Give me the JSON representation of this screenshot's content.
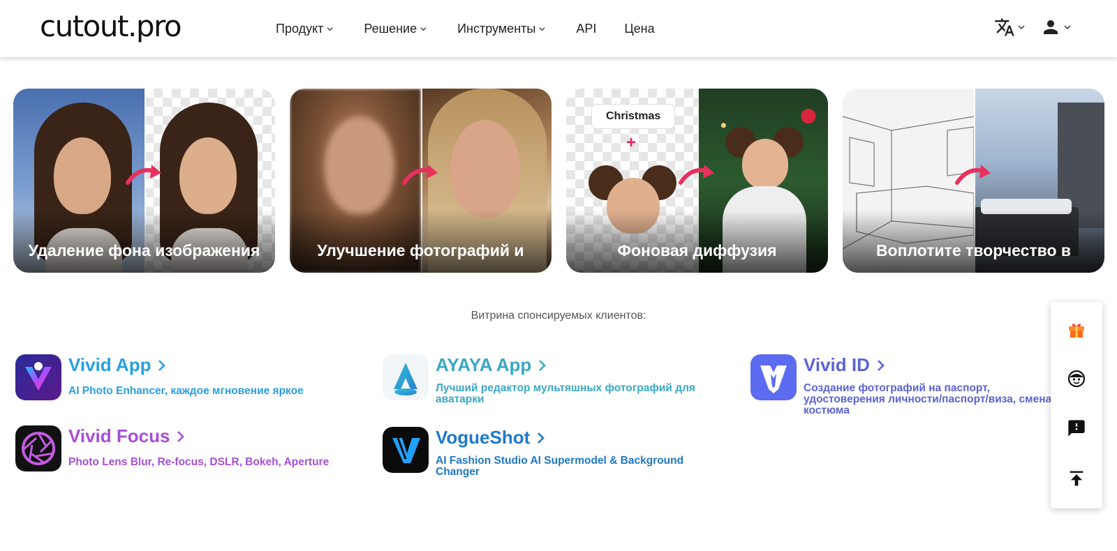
{
  "header": {
    "logo": "cutout.pro",
    "nav": [
      "Продукт",
      "Решение",
      "Инструменты",
      "API",
      "Цена"
    ],
    "icons": [
      "translate-icon",
      "user-icon"
    ]
  },
  "cards": [
    {
      "caption": "Удаление фона изображения"
    },
    {
      "caption": "Улучшение фотографий и"
    },
    {
      "caption": "Фоновая диффузия",
      "badge": "Christmas",
      "plus": "+"
    },
    {
      "caption": "Воплотите творчество в"
    }
  ],
  "sponsored": {
    "title": "Витрина спонсируемых клиентов:",
    "items": [
      {
        "name": "Vivid App",
        "desc_part1": "AI Photo Enhancer",
        "desc_part2": ", каждое мгновение яркое",
        "color": "#2a9fe0"
      },
      {
        "name": "AYAYA App",
        "desc": "Лучший редактор мультяшных фотографий для аватарки",
        "color": "#3aa8c4"
      },
      {
        "name": "Vivid ID",
        "desc": "Создание фотографий на паспорт, удостоверения личности/паспорт/виза, смена костюма",
        "color": "#5b63d8"
      },
      {
        "name": "Vivid Focus",
        "desc": "Photo Lens Blur, Re-focus, DSLR, Bokeh, Aperture",
        "color": "#a64fd6"
      },
      {
        "name": "VogueShot",
        "desc": "AI Fashion Studio AI Supermodel & Background Changer",
        "color": "#1f78c8"
      }
    ]
  },
  "floating": [
    "gift-icon",
    "support-icon",
    "feedback-icon",
    "back-to-top-icon"
  ]
}
